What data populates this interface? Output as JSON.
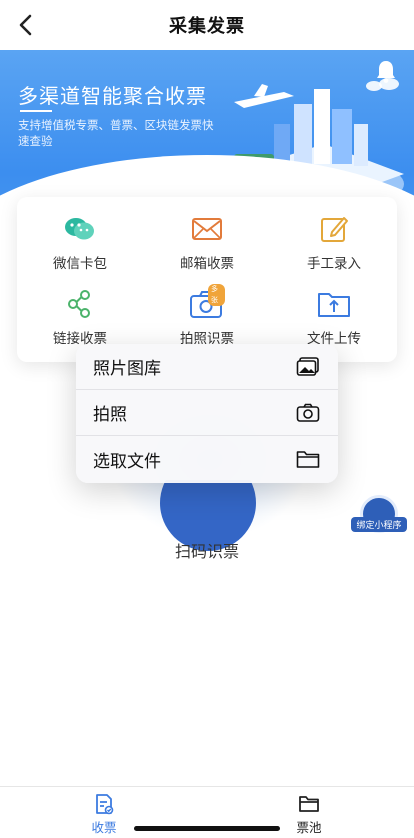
{
  "header": {
    "title": "采集发票"
  },
  "banner": {
    "title": "多渠道智能聚合收票",
    "subtitle": "支持增值税专票、普票、区块链发票快速查验"
  },
  "options": [
    {
      "label": "微信卡包"
    },
    {
      "label": "邮箱收票"
    },
    {
      "label": "手工录入"
    },
    {
      "label": "链接收票"
    },
    {
      "label": "拍照识票",
      "badge": "多张"
    },
    {
      "label": "文件上传"
    }
  ],
  "popup": {
    "items": [
      {
        "label": "照片图库"
      },
      {
        "label": "拍照"
      },
      {
        "label": "选取文件"
      }
    ]
  },
  "scan": {
    "label": "扫码识票"
  },
  "mini_program": {
    "label": "绑定小程序"
  },
  "tabbar": {
    "tabs": [
      {
        "label": "收票",
        "active": true
      },
      {
        "label": "票池",
        "active": false
      }
    ]
  },
  "colors": {
    "accent": "#3c7be0",
    "banner": "#4a98f0",
    "wechat": "#2cb8a0",
    "mail": "#e27b3b",
    "manual": "#e3a73a"
  }
}
